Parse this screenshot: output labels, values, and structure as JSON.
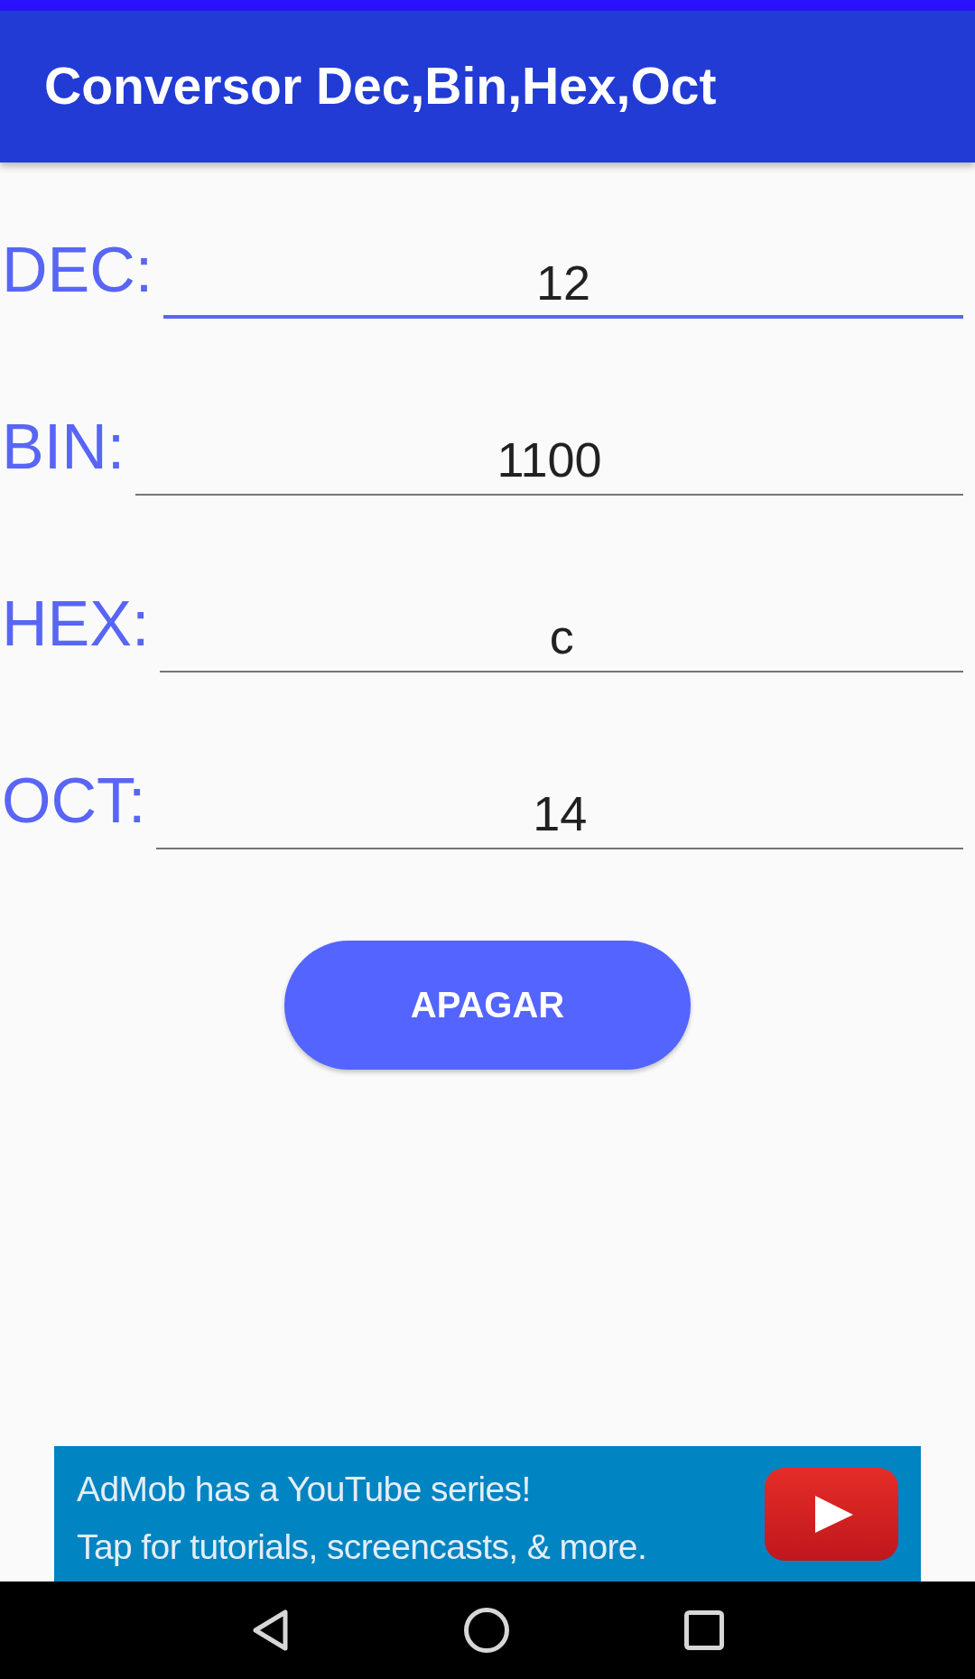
{
  "app_bar": {
    "title": "Conversor Dec,Bin,Hex,Oct"
  },
  "fields": [
    {
      "label": "DEC:",
      "value": "12",
      "focused": true
    },
    {
      "label": "BIN:",
      "value": "1100",
      "focused": false
    },
    {
      "label": "HEX:",
      "value": "c",
      "focused": false
    },
    {
      "label": "OCT:",
      "value": "14",
      "focused": false
    }
  ],
  "button": {
    "label": "APAGAR"
  },
  "ad_banner": {
    "lines": [
      "AdMob has a YouTube series!",
      "Tap for tutorials, screencasts, & more."
    ]
  }
}
